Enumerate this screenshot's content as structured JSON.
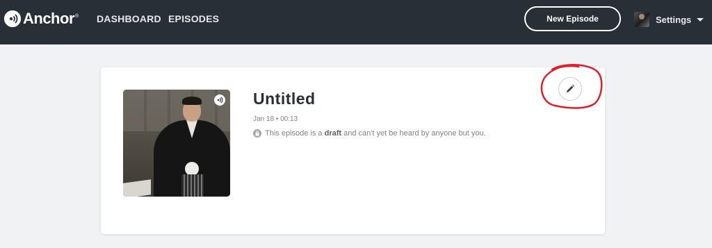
{
  "header": {
    "brand": "Anchor",
    "brand_mark": "®",
    "nav": [
      {
        "label": "DASHBOARD"
      },
      {
        "label": "EPISODES"
      }
    ],
    "new_episode_label": "New Episode",
    "settings_label": "Settings"
  },
  "episode": {
    "title": "Untitled",
    "meta": "Jan 18 • 00:13",
    "draft_prefix": "This episode is a ",
    "draft_word": "draft",
    "draft_suffix": " and can't yet be heard by anyone but you."
  },
  "icons": {
    "logo": "anchor-logo-icon",
    "audio": "speaker-icon",
    "lock": "lock-icon",
    "edit": "pencil-icon",
    "dropdown": "chevron-down-icon"
  },
  "colors": {
    "topbar": "#292f36",
    "annotation": "#e11d2a",
    "text_dark": "#292f36",
    "text_muted": "#7f8287"
  }
}
